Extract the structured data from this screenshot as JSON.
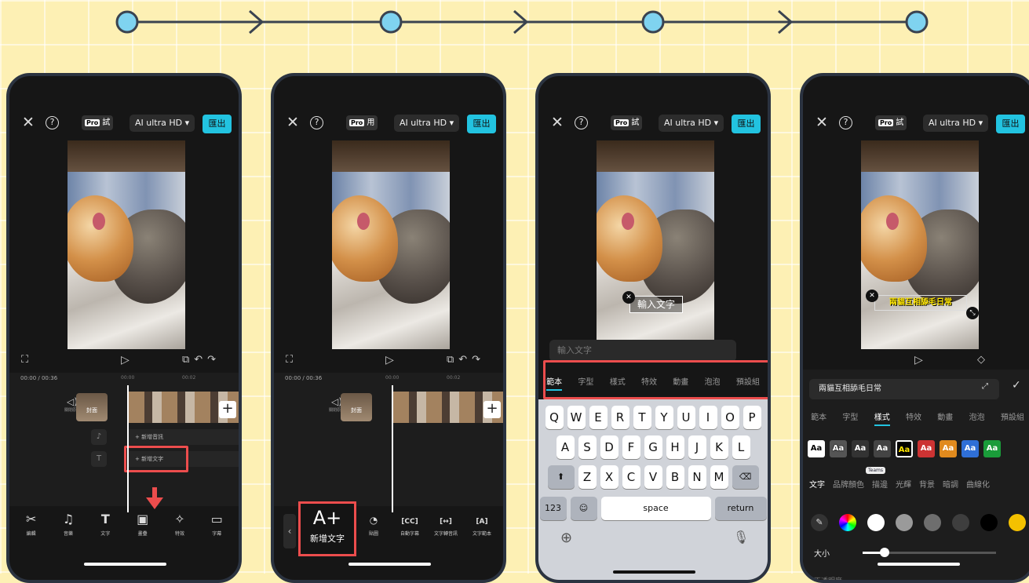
{
  "header": {
    "pro_badge": "Pro",
    "ai_hd": "AI ultra HD",
    "export": "匯出"
  },
  "pro_suffix": [
    "試",
    "用",
    "試",
    "試"
  ],
  "timeline": {
    "timecode": "00:00 / 00:36",
    "t0": "00:00",
    "t2": "00:02",
    "mute": "關閉原音",
    "cover": "封面",
    "add_audio": "+ 新增音訊",
    "add_text": "+ 新增文字"
  },
  "tools": [
    {
      "icon": "✂",
      "label": "編輯"
    },
    {
      "icon": "♫",
      "label": "音樂"
    },
    {
      "icon": "T",
      "label": "文字"
    },
    {
      "icon": "▣",
      "label": "畫疊"
    },
    {
      "icon": "✧",
      "label": "特效"
    },
    {
      "icon": "▭",
      "label": "字幕"
    }
  ],
  "phone2": {
    "add_text_big": "A+",
    "add_text_label": "新增文字",
    "tools": [
      {
        "icon": "◔",
        "label": "貼圖"
      },
      {
        "icon": "[CC]",
        "label": "自動字幕"
      },
      {
        "icon": "[↔]",
        "label": "文字轉音訊"
      },
      {
        "icon": "[A]",
        "label": "文字範本"
      }
    ]
  },
  "phone3": {
    "input_box": "輸入文字",
    "input_placeholder": "輸入文字",
    "tabs": [
      "範本",
      "字型",
      "樣式",
      "特效",
      "動畫",
      "泡泡",
      "預設組"
    ],
    "row1": [
      "Q",
      "W",
      "E",
      "R",
      "T",
      "Y",
      "U",
      "I",
      "O",
      "P"
    ],
    "row2": [
      "A",
      "S",
      "D",
      "F",
      "G",
      "H",
      "J",
      "K",
      "L"
    ],
    "row3": [
      "Z",
      "X",
      "C",
      "V",
      "B",
      "N",
      "M"
    ],
    "num": "123",
    "space": "space",
    "return": "return"
  },
  "phone4": {
    "caption": "兩貓互相舔毛日常",
    "name": "兩貓互相舔毛日常",
    "tabs": [
      "範本",
      "字型",
      "樣式",
      "特效",
      "動畫",
      "泡泡",
      "預設組"
    ],
    "presets": [
      "Aa",
      "Aa",
      "Aa",
      "Aa",
      "Aa",
      "Aa",
      "Aa",
      "Aa",
      "Aa"
    ],
    "subtabs": [
      "文字",
      "品牌顏色",
      "描邊",
      "光輝",
      "背景",
      "暗調",
      "曲線化"
    ],
    "teams": "Teams",
    "size": "大小",
    "opacity": "不透明度"
  },
  "colors": {
    "accent": "#22c3e0",
    "highlight": "#ec4d4d",
    "flow_node": "#7fd3f0"
  }
}
